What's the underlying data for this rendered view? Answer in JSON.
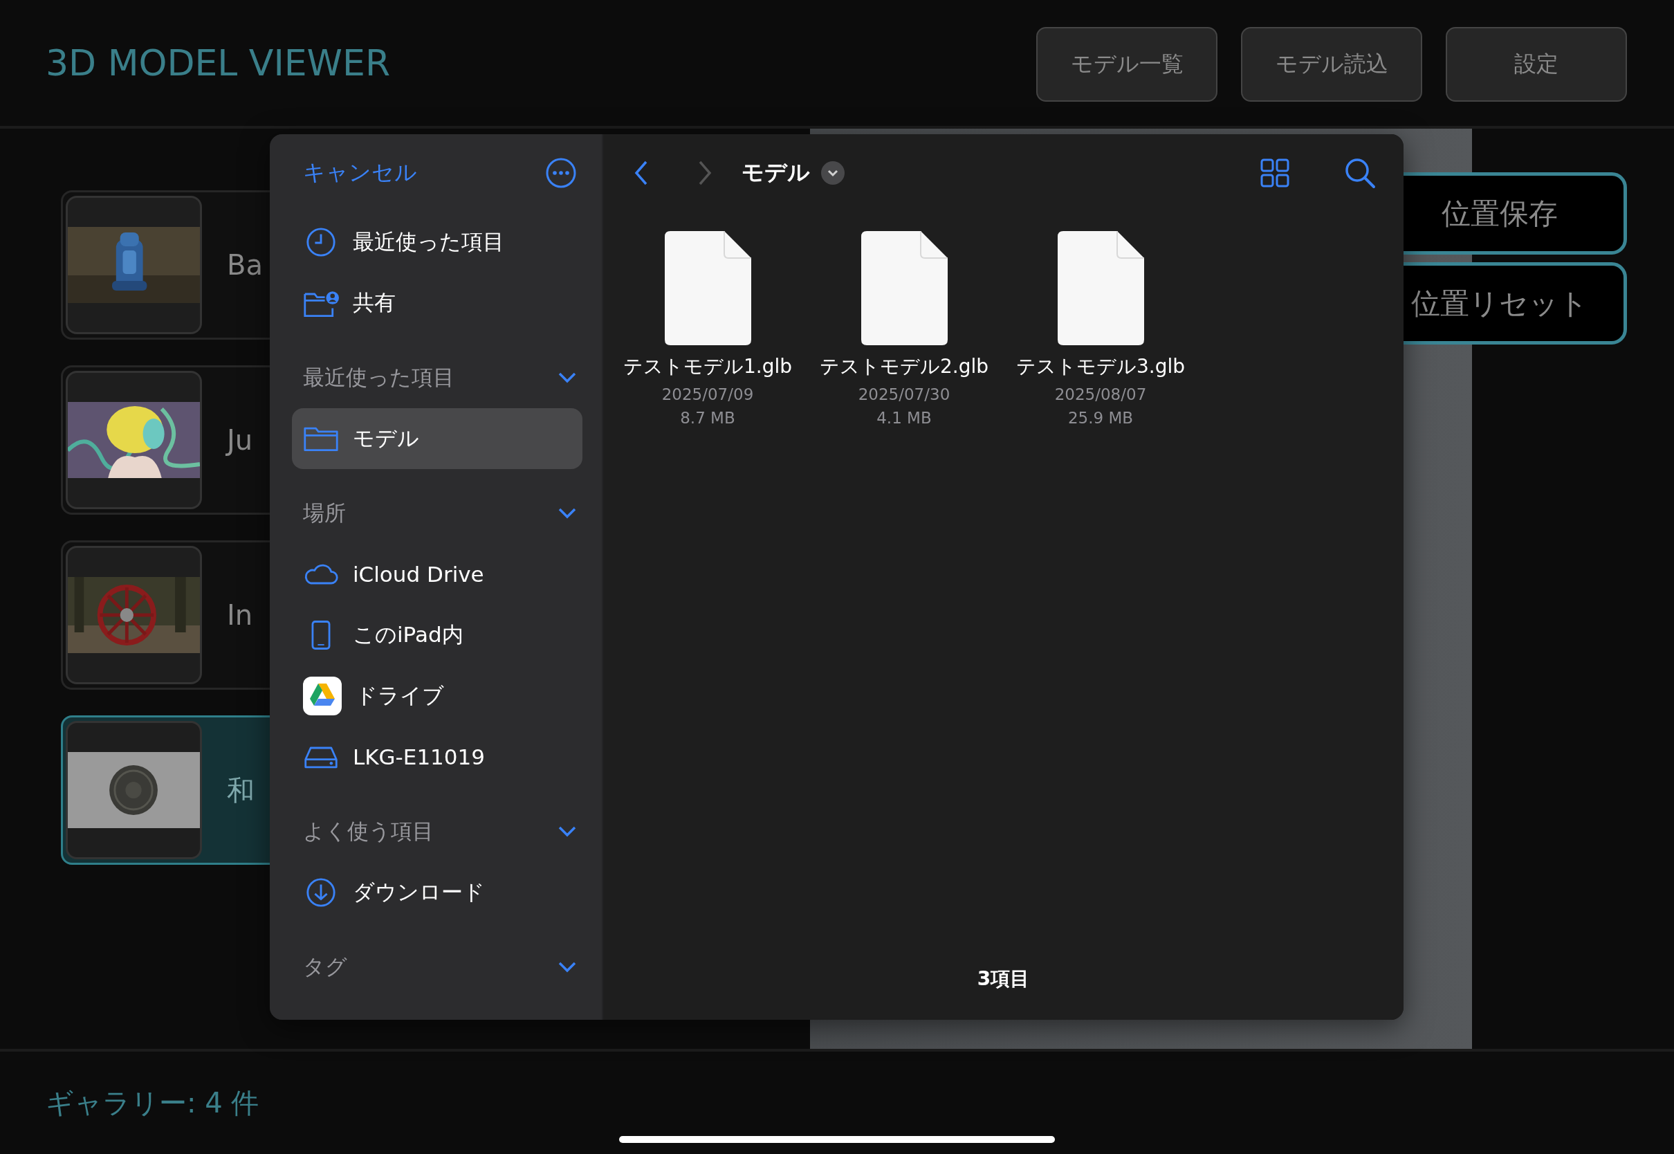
{
  "header": {
    "title": "3D MODEL VIEWER",
    "buttons": [
      "モデル一覧",
      "モデル読込",
      "設定"
    ]
  },
  "gallery": {
    "items": [
      {
        "label": "Ba",
        "selected": false
      },
      {
        "label": "Ju",
        "selected": false
      },
      {
        "label": "In",
        "selected": false
      },
      {
        "label": "和",
        "selected": true
      }
    ]
  },
  "viewer": {
    "buttons": [
      "位置保存",
      "位置リセット"
    ]
  },
  "file_picker": {
    "cancel": "キャンセル",
    "top_items": [
      {
        "label": "最近使った項目",
        "selected": false
      },
      {
        "label": "共有",
        "selected": false
      }
    ],
    "sections": [
      {
        "title": "最近使った項目",
        "expanded": true,
        "items": [
          {
            "label": "モデル",
            "selected": true
          }
        ]
      },
      {
        "title": "場所",
        "expanded": true,
        "items": [
          {
            "label": "iCloud Drive",
            "selected": false
          },
          {
            "label": "このiPad内",
            "selected": false
          },
          {
            "label": "ドライブ",
            "selected": false
          },
          {
            "label": "LKG-E11019",
            "selected": false
          }
        ]
      },
      {
        "title": "よく使う項目",
        "expanded": true,
        "items": [
          {
            "label": "ダウンロード",
            "selected": false
          }
        ]
      },
      {
        "title": "タグ",
        "expanded": true
      }
    ],
    "toolbar": {
      "title": "モデル",
      "back_disabled": false,
      "forward_disabled": true
    },
    "files": [
      {
        "name": "テストモデル1.glb",
        "date": "2025/07/09",
        "size": "8.7 MB"
      },
      {
        "name": "テストモデル2.glb",
        "date": "2025/07/30",
        "size": "4.1 MB"
      },
      {
        "name": "テストモデル3.glb",
        "date": "2025/08/07",
        "size": "25.9 MB"
      }
    ],
    "footer": "3項目"
  },
  "status_bar": {
    "text": "ギャラリー: 4 件"
  }
}
